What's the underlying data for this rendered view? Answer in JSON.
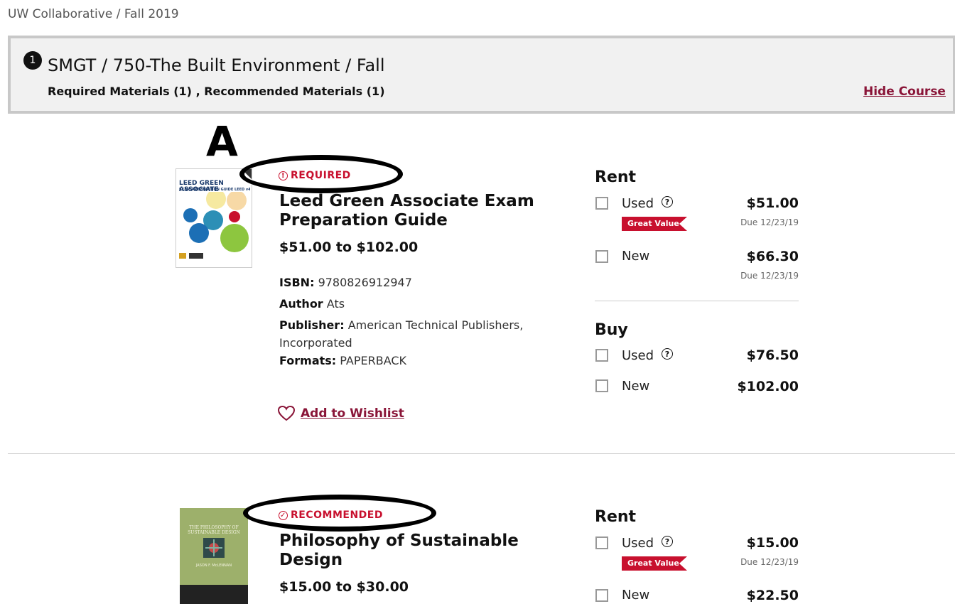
{
  "breadcrumb": "UW Collaborative / Fall 2019",
  "course": {
    "number": "1",
    "title": "SMGT / 750-The Built Environment / Fall",
    "materials": "Required Materials (1) , Recommended Materials (1)",
    "hide_label": "Hide Course"
  },
  "annotation_letter": "A",
  "books": [
    {
      "badge": "REQUIRED",
      "title": "Leed Green Associate Exam Preparation Guide",
      "price_range": "$51.00 to $102.00",
      "isbn_label": "ISBN:",
      "isbn": "9780826912947",
      "author_label": "Author",
      "author": "Ats",
      "publisher_label": "Publisher:",
      "publisher": "American Technical Publishers, Incorporated",
      "formats_label": "Formats:",
      "formats": "PAPERBACK",
      "wishlist": "Add to Wishlist",
      "cover_title": "LEED GREEN ASSOCIATE",
      "cover_subtitle": "EXAM PREPARATION GUIDE LEED v4 EDITION",
      "rent_label": "Rent",
      "buy_label": "Buy",
      "rent": [
        {
          "label": "Used",
          "price": "$51.00",
          "due": "Due 12/23/19",
          "great_value": "Great Value"
        },
        {
          "label": "New",
          "price": "$66.30",
          "due": "Due 12/23/19"
        }
      ],
      "buy": [
        {
          "label": "Used",
          "price": "$76.50"
        },
        {
          "label": "New",
          "price": "$102.00"
        }
      ]
    },
    {
      "badge": "RECOMMENDED",
      "title": "Philosophy of Sustainable Design",
      "price_range": "$15.00 to $30.00",
      "cover_title": "THE PHILOSOPHY OF SUSTAINABLE DESIGN",
      "cover_author": "JASON F. McLENNAN",
      "rent_label": "Rent",
      "rent": [
        {
          "label": "Used",
          "price": "$15.00",
          "due": "Due 12/23/19",
          "great_value": "Great Value"
        },
        {
          "label": "New",
          "price": "$22.50"
        }
      ]
    }
  ],
  "colors": {
    "accent": "#c8102e",
    "link": "#8a1538",
    "course_bg": "#f1f1f1"
  }
}
